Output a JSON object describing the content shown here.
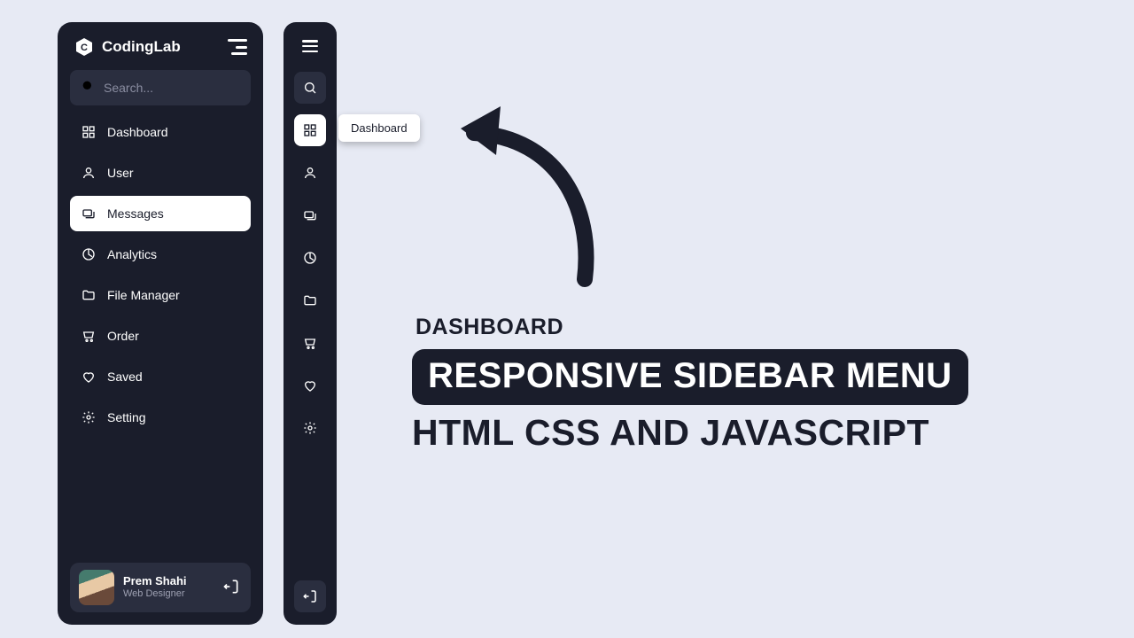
{
  "brand": {
    "name": "CodingLab"
  },
  "search": {
    "placeholder": "Search..."
  },
  "nav": {
    "items": [
      {
        "label": "Dashboard"
      },
      {
        "label": "User"
      },
      {
        "label": "Messages"
      },
      {
        "label": "Analytics"
      },
      {
        "label": "File Manager"
      },
      {
        "label": "Order"
      },
      {
        "label": "Saved"
      },
      {
        "label": "Setting"
      }
    ],
    "active_index_expanded": 2,
    "active_index_collapsed": 0
  },
  "user": {
    "name": "Prem Shahi",
    "role": "Web Designer"
  },
  "tooltip": {
    "label": "Dashboard"
  },
  "headline": {
    "kicker": "DASHBOARD",
    "pill": "RESPONSIVE SIDEBAR MENU",
    "sub": "HTML CSS AND JAVASCRIPT"
  }
}
